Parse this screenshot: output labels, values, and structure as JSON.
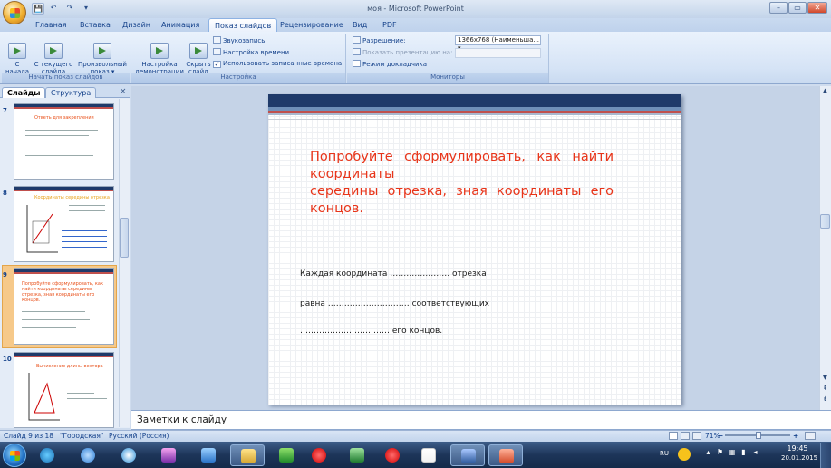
{
  "window": {
    "title": "моя - Microsoft PowerPoint",
    "minimize": "–",
    "maximize": "▭",
    "close": "✕"
  },
  "qat": {
    "save": "💾",
    "undo": "↶",
    "redo": "↷",
    "more": "▾"
  },
  "tabs": [
    "Главная",
    "Вставка",
    "Дизайн",
    "Анимация",
    "Показ слайдов",
    "Рецензирование",
    "Вид",
    "PDF"
  ],
  "active_tab": "Показ слайдов",
  "ribbon": {
    "start_group": {
      "label": "Начать показ слайдов",
      "from_start": "С\nначала",
      "from_current": "С текущего\nслайда",
      "custom": "Произвольный\nпоказ ▾"
    },
    "setup_group": {
      "label": "Настройка",
      "setup_show": "Настройка\nдемонстрации",
      "hide_slide": "Скрыть\nслайд",
      "record_narration": "Звукозапись",
      "rehearse": "Настройка времени",
      "use_timings": "Использовать записанные времена"
    },
    "monitors_group": {
      "label": "Мониторы",
      "resolution_label": "Разрешение:",
      "resolution_value": "1366x768 (Наименьша... ▾",
      "show_on_label": "Показать презентацию на:",
      "presenter_view": "Режим докладчика"
    }
  },
  "slides_pane": {
    "tab_slides": "Слайды",
    "tab_outline": "Структура",
    "close": "×",
    "thumbnails": [
      {
        "num": "7",
        "title": "Ответь для закрепления"
      },
      {
        "num": "8",
        "title": "Координаты середины отрезка"
      },
      {
        "num": "9",
        "title": "Попробуйте сформулировать, как найти координаты середины отрезка, зная координаты его концов."
      },
      {
        "num": "10",
        "title": "Вычисление длины вектора"
      }
    ]
  },
  "slide": {
    "title": "Попробуйте сформулировать, как найти координаты\n середины отрезка, зная координаты его концов.",
    "line1": "Каждая  координата  …………………. отрезка",
    "line2": "равна  ………………………… соответствующих",
    "line3": "……………………………  его  концов."
  },
  "notes": {
    "placeholder": "Заметки к слайду"
  },
  "status": {
    "slide_info": "Слайд 9 из 18",
    "theme": "\"Городская\"",
    "language": "Русский (Россия)",
    "zoom": "71%",
    "zoom_minus": "−",
    "zoom_plus": "+"
  },
  "taskbar": {
    "lang": "RU",
    "time": "19:45",
    "date": "20.01.2015"
  }
}
